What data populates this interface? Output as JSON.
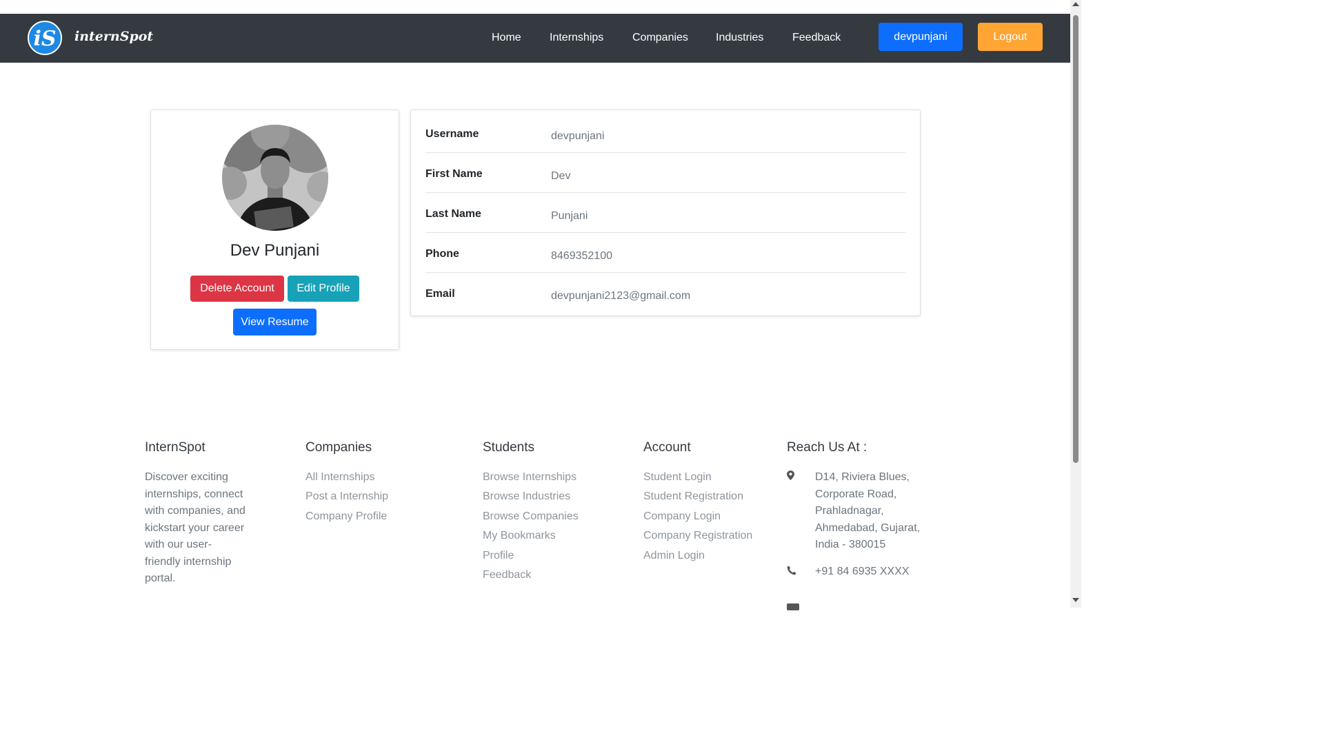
{
  "brand": {
    "logo_text": "iS",
    "name": "internSpot"
  },
  "nav": {
    "links": [
      "Home",
      "Internships",
      "Companies",
      "Industries",
      "Feedback"
    ],
    "user_button": "devpunjani",
    "logout_button": "Logout"
  },
  "profile": {
    "full_name": "Dev Punjani",
    "delete_button": "Delete Account",
    "edit_button": "Edit Profile",
    "resume_button": "View Resume",
    "fields": [
      {
        "label": "Username",
        "value": "devpunjani"
      },
      {
        "label": "First Name",
        "value": "Dev"
      },
      {
        "label": "Last Name",
        "value": "Punjani"
      },
      {
        "label": "Phone",
        "value": "8469352100"
      },
      {
        "label": "Email",
        "value": "devpunjani2123@gmail.com"
      }
    ]
  },
  "footer": {
    "about": {
      "heading": "InternSpot",
      "lines": [
        "Discover exciting",
        "internships, connect",
        "with companies, and",
        "kickstart your career",
        "with our user-",
        "friendly internship",
        "portal."
      ]
    },
    "companies": {
      "heading": "Companies",
      "links": [
        "All Internships",
        "Post a Internship",
        "Company Profile"
      ]
    },
    "students": {
      "heading": "Students",
      "links": [
        "Browse Internships",
        "Browse Industries",
        "Browse Companies",
        "My Bookmarks",
        "Profile",
        "Feedback"
      ]
    },
    "account": {
      "heading": "Account",
      "links": [
        "Student Login",
        "Student Registration",
        "Company Login",
        "Company Registration",
        "Admin Login"
      ]
    },
    "contact": {
      "heading": "Reach Us At :",
      "address_lines": [
        "D14, Riviera Blues,",
        "Corporate Road,",
        "Prahladnagar,",
        "Ahmedabad, Gujarat,",
        "India - 380015"
      ],
      "phone": "+91 84 6935 XXXX"
    }
  },
  "colors": {
    "navbar": "#343a40",
    "primary": "#0d6efd",
    "danger": "#dc3545",
    "info": "#17a2b8",
    "warning": "#ffa534"
  },
  "icons": [
    "map-pin-icon",
    "phone-icon",
    "mail-icon"
  ]
}
